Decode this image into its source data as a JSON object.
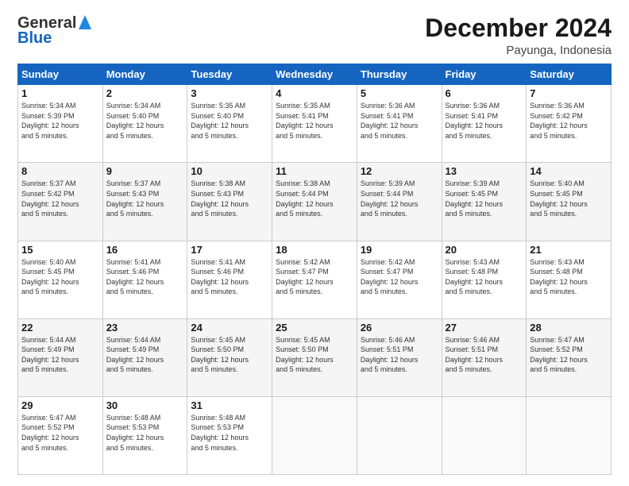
{
  "logo": {
    "general": "General",
    "blue": "Blue"
  },
  "header": {
    "month": "December 2024",
    "location": "Payunga, Indonesia"
  },
  "weekdays": [
    "Sunday",
    "Monday",
    "Tuesday",
    "Wednesday",
    "Thursday",
    "Friday",
    "Saturday"
  ],
  "weeks": [
    [
      {
        "day": "1",
        "info": "Sunrise: 5:34 AM\nSunset: 5:39 PM\nDaylight: 12 hours\nand 5 minutes."
      },
      {
        "day": "2",
        "info": "Sunrise: 5:34 AM\nSunset: 5:40 PM\nDaylight: 12 hours\nand 5 minutes."
      },
      {
        "day": "3",
        "info": "Sunrise: 5:35 AM\nSunset: 5:40 PM\nDaylight: 12 hours\nand 5 minutes."
      },
      {
        "day": "4",
        "info": "Sunrise: 5:35 AM\nSunset: 5:41 PM\nDaylight: 12 hours\nand 5 minutes."
      },
      {
        "day": "5",
        "info": "Sunrise: 5:36 AM\nSunset: 5:41 PM\nDaylight: 12 hours\nand 5 minutes."
      },
      {
        "day": "6",
        "info": "Sunrise: 5:36 AM\nSunset: 5:41 PM\nDaylight: 12 hours\nand 5 minutes."
      },
      {
        "day": "7",
        "info": "Sunrise: 5:36 AM\nSunset: 5:42 PM\nDaylight: 12 hours\nand 5 minutes."
      }
    ],
    [
      {
        "day": "8",
        "info": "Sunrise: 5:37 AM\nSunset: 5:42 PM\nDaylight: 12 hours\nand 5 minutes."
      },
      {
        "day": "9",
        "info": "Sunrise: 5:37 AM\nSunset: 5:43 PM\nDaylight: 12 hours\nand 5 minutes."
      },
      {
        "day": "10",
        "info": "Sunrise: 5:38 AM\nSunset: 5:43 PM\nDaylight: 12 hours\nand 5 minutes."
      },
      {
        "day": "11",
        "info": "Sunrise: 5:38 AM\nSunset: 5:44 PM\nDaylight: 12 hours\nand 5 minutes."
      },
      {
        "day": "12",
        "info": "Sunrise: 5:39 AM\nSunset: 5:44 PM\nDaylight: 12 hours\nand 5 minutes."
      },
      {
        "day": "13",
        "info": "Sunrise: 5:39 AM\nSunset: 5:45 PM\nDaylight: 12 hours\nand 5 minutes."
      },
      {
        "day": "14",
        "info": "Sunrise: 5:40 AM\nSunset: 5:45 PM\nDaylight: 12 hours\nand 5 minutes."
      }
    ],
    [
      {
        "day": "15",
        "info": "Sunrise: 5:40 AM\nSunset: 5:45 PM\nDaylight: 12 hours\nand 5 minutes."
      },
      {
        "day": "16",
        "info": "Sunrise: 5:41 AM\nSunset: 5:46 PM\nDaylight: 12 hours\nand 5 minutes."
      },
      {
        "day": "17",
        "info": "Sunrise: 5:41 AM\nSunset: 5:46 PM\nDaylight: 12 hours\nand 5 minutes."
      },
      {
        "day": "18",
        "info": "Sunrise: 5:42 AM\nSunset: 5:47 PM\nDaylight: 12 hours\nand 5 minutes."
      },
      {
        "day": "19",
        "info": "Sunrise: 5:42 AM\nSunset: 5:47 PM\nDaylight: 12 hours\nand 5 minutes."
      },
      {
        "day": "20",
        "info": "Sunrise: 5:43 AM\nSunset: 5:48 PM\nDaylight: 12 hours\nand 5 minutes."
      },
      {
        "day": "21",
        "info": "Sunrise: 5:43 AM\nSunset: 5:48 PM\nDaylight: 12 hours\nand 5 minutes."
      }
    ],
    [
      {
        "day": "22",
        "info": "Sunrise: 5:44 AM\nSunset: 5:49 PM\nDaylight: 12 hours\nand 5 minutes."
      },
      {
        "day": "23",
        "info": "Sunrise: 5:44 AM\nSunset: 5:49 PM\nDaylight: 12 hours\nand 5 minutes."
      },
      {
        "day": "24",
        "info": "Sunrise: 5:45 AM\nSunset: 5:50 PM\nDaylight: 12 hours\nand 5 minutes."
      },
      {
        "day": "25",
        "info": "Sunrise: 5:45 AM\nSunset: 5:50 PM\nDaylight: 12 hours\nand 5 minutes."
      },
      {
        "day": "26",
        "info": "Sunrise: 5:46 AM\nSunset: 5:51 PM\nDaylight: 12 hours\nand 5 minutes."
      },
      {
        "day": "27",
        "info": "Sunrise: 5:46 AM\nSunset: 5:51 PM\nDaylight: 12 hours\nand 5 minutes."
      },
      {
        "day": "28",
        "info": "Sunrise: 5:47 AM\nSunset: 5:52 PM\nDaylight: 12 hours\nand 5 minutes."
      }
    ],
    [
      {
        "day": "29",
        "info": "Sunrise: 5:47 AM\nSunset: 5:52 PM\nDaylight: 12 hours\nand 5 minutes."
      },
      {
        "day": "30",
        "info": "Sunrise: 5:48 AM\nSunset: 5:53 PM\nDaylight: 12 hours\nand 5 minutes."
      },
      {
        "day": "31",
        "info": "Sunrise: 5:48 AM\nSunset: 5:53 PM\nDaylight: 12 hours\nand 5 minutes."
      },
      {
        "day": "",
        "info": ""
      },
      {
        "day": "",
        "info": ""
      },
      {
        "day": "",
        "info": ""
      },
      {
        "day": "",
        "info": ""
      }
    ]
  ]
}
